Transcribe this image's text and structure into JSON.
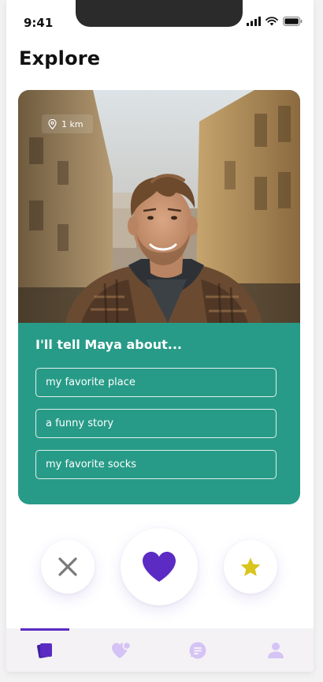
{
  "status_bar": {
    "time": "9:41"
  },
  "header": {
    "title": "Explore"
  },
  "profile_card": {
    "distance": "1 km",
    "prompt_title": "I'll tell Maya about...",
    "options": [
      {
        "label": "my favorite place"
      },
      {
        "label": "a funny story"
      },
      {
        "label": "my favorite socks"
      }
    ],
    "accent_color": "#279b87"
  },
  "actions": {
    "dislike": {
      "icon": "close-icon"
    },
    "like": {
      "icon": "heart-icon",
      "color": "#5b2bc4"
    },
    "super_like": {
      "icon": "star-icon",
      "color": "#d9c51e"
    }
  },
  "tab_bar": {
    "active_index": 0,
    "tabs": [
      {
        "icon": "cards-icon"
      },
      {
        "icon": "likes-icon"
      },
      {
        "icon": "chat-icon"
      },
      {
        "icon": "profile-icon"
      }
    ],
    "active_color": "#5b2bc4",
    "inactive_color": "#d6c3f5"
  }
}
